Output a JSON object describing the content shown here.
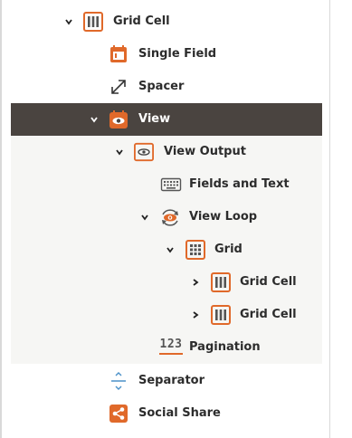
{
  "tree": {
    "items": [
      {
        "label": "Grid Cell",
        "icon": "grid-cell-icon",
        "expanded": true
      },
      {
        "label": "Single Field",
        "icon": "single-field-icon"
      },
      {
        "label": "Spacer",
        "icon": "spacer-icon"
      },
      {
        "label": "View",
        "icon": "view-icon",
        "expanded": true,
        "selected": true
      },
      {
        "label": "View Output",
        "icon": "view-output-icon",
        "expanded": true
      },
      {
        "label": "Fields and Text",
        "icon": "keyboard-icon"
      },
      {
        "label": "View Loop",
        "icon": "view-loop-icon",
        "expanded": true
      },
      {
        "label": "Grid",
        "icon": "grid-icon",
        "expanded": true
      },
      {
        "label": "Grid Cell",
        "icon": "grid-cell-icon",
        "expanded": false
      },
      {
        "label": "Grid Cell",
        "icon": "grid-cell-icon",
        "expanded": false
      },
      {
        "label": "Pagination",
        "icon": "pagination-icon",
        "icon_text": "123"
      },
      {
        "label": "Separator",
        "icon": "separator-icon"
      },
      {
        "label": "Social Share",
        "icon": "social-share-icon"
      }
    ]
  },
  "colors": {
    "accent": "#e0692a",
    "selected_bg": "#4a4440",
    "nested_bg": "#f6f6f4",
    "text": "#2c2c2c"
  }
}
